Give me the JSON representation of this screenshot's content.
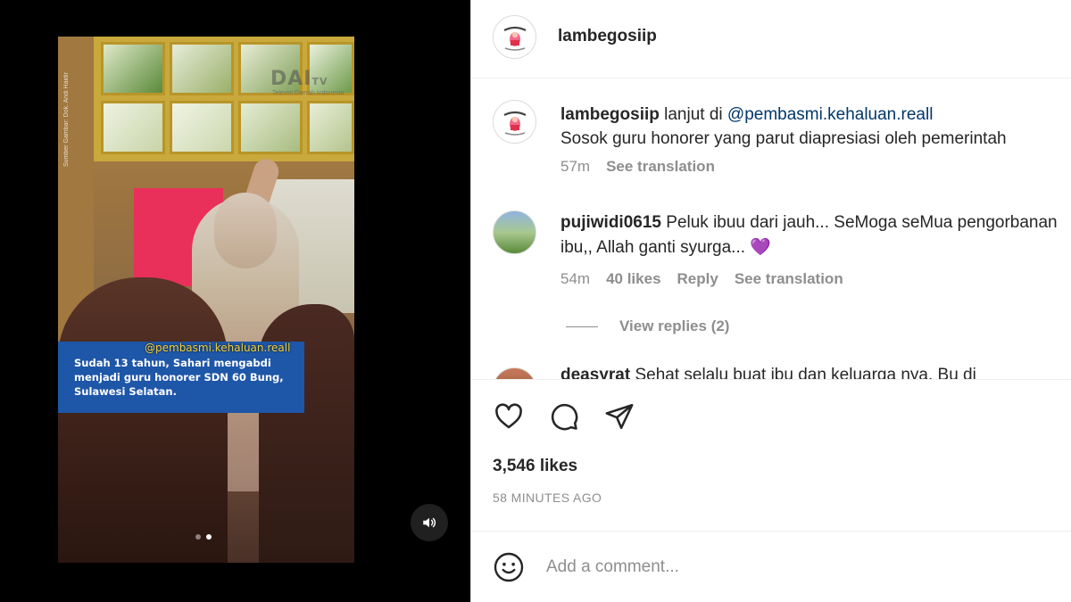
{
  "media": {
    "caption_overlay": "Sudah 13 tahun, Sahari mengabdi menjadi guru honorer SDN 60 Bung, Sulawesi Selatan.",
    "handle_overlay": "@pembasmi.kehaluan.reall",
    "watermark": "DAI",
    "watermark_suffix": "TV",
    "watermark_sub": "Televisi Daerah Indonesia",
    "source_credit": "Sumber Gambar: Dok. Andi Haidir",
    "carousel": {
      "total": 2,
      "active": 2
    }
  },
  "post": {
    "author": "lambegosiip",
    "caption": {
      "username": "lambegosiip",
      "text_before": "lanjut di",
      "mention": "@pembasmi.kehaluan.reall",
      "line2": "Sosok guru honorer yang parut diapresiasi oleh pemerintah",
      "time": "57m",
      "see_translation": "See translation"
    },
    "comments": [
      {
        "username": "pujiwidi0615",
        "text": "Peluk ibuu dari jauh... SeMoga seMua pengorbanan ibu,, Allah ganti syurga... 💜",
        "time": "54m",
        "likes": "40 likes",
        "reply": "Reply",
        "see_translation": "See translation",
        "view_replies": "View replies (2)"
      },
      {
        "username": "deasyrat",
        "text": "Sehat selalu buat ibu dan keluarga nya. Bu di"
      }
    ],
    "likes": "3,546 likes",
    "timestamp": "58 MINUTES AGO",
    "comment_placeholder": "Add a comment..."
  }
}
